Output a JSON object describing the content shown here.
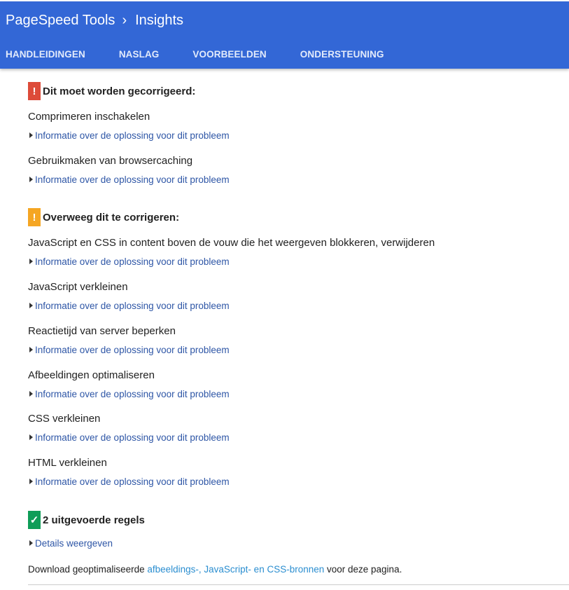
{
  "header": {
    "brand": "PageSpeed Tools",
    "separator": "›",
    "section": "Insights",
    "nav": [
      "HANDLEIDINGEN",
      "NASLAG",
      "VOORBEELDEN",
      "ONDERSTEUNING"
    ]
  },
  "should_fix": {
    "icon": "!",
    "title": "Dit moet worden gecorrigeerd:",
    "color": "#dd4b39",
    "rules": [
      {
        "title": "Comprimeren inschakelen",
        "link": "Informatie over de oplossing voor dit probleem"
      },
      {
        "title": "Gebruikmaken van browsercaching",
        "link": "Informatie over de oplossing voor dit probleem"
      }
    ]
  },
  "consider_fixing": {
    "icon": "!",
    "title": "Overweeg dit te corrigeren:",
    "color": "#f5a623",
    "rules": [
      {
        "title": "JavaScript en CSS in content boven de vouw die het weergeven blokkeren, verwijderen",
        "link": "Informatie over de oplossing voor dit probleem"
      },
      {
        "title": "JavaScript verkleinen",
        "link": "Informatie over de oplossing voor dit probleem"
      },
      {
        "title": "Reactietijd van server beperken",
        "link": "Informatie over de oplossing voor dit probleem"
      },
      {
        "title": "Afbeeldingen optimaliseren",
        "link": "Informatie over de oplossing voor dit probleem"
      },
      {
        "title": "CSS verkleinen",
        "link": "Informatie over de oplossing voor dit probleem"
      },
      {
        "title": "HTML verkleinen",
        "link": "Informatie over de oplossing voor dit probleem"
      }
    ]
  },
  "passed": {
    "icon": "✓",
    "title": "2 uitgevoerde regels",
    "color": "#0f9d58",
    "link": "Details weergeven"
  },
  "download": {
    "prefix": "Download geoptimaliseerde ",
    "link": "afbeeldings-, JavaScript- en CSS-bronnen",
    "suffix": " voor deze pagina."
  },
  "icons": {
    "breadcrumb": "chevron-right-icon",
    "expand": "triangle-right-icon",
    "error": "exclamation-icon",
    "pass": "checkmark-icon"
  }
}
